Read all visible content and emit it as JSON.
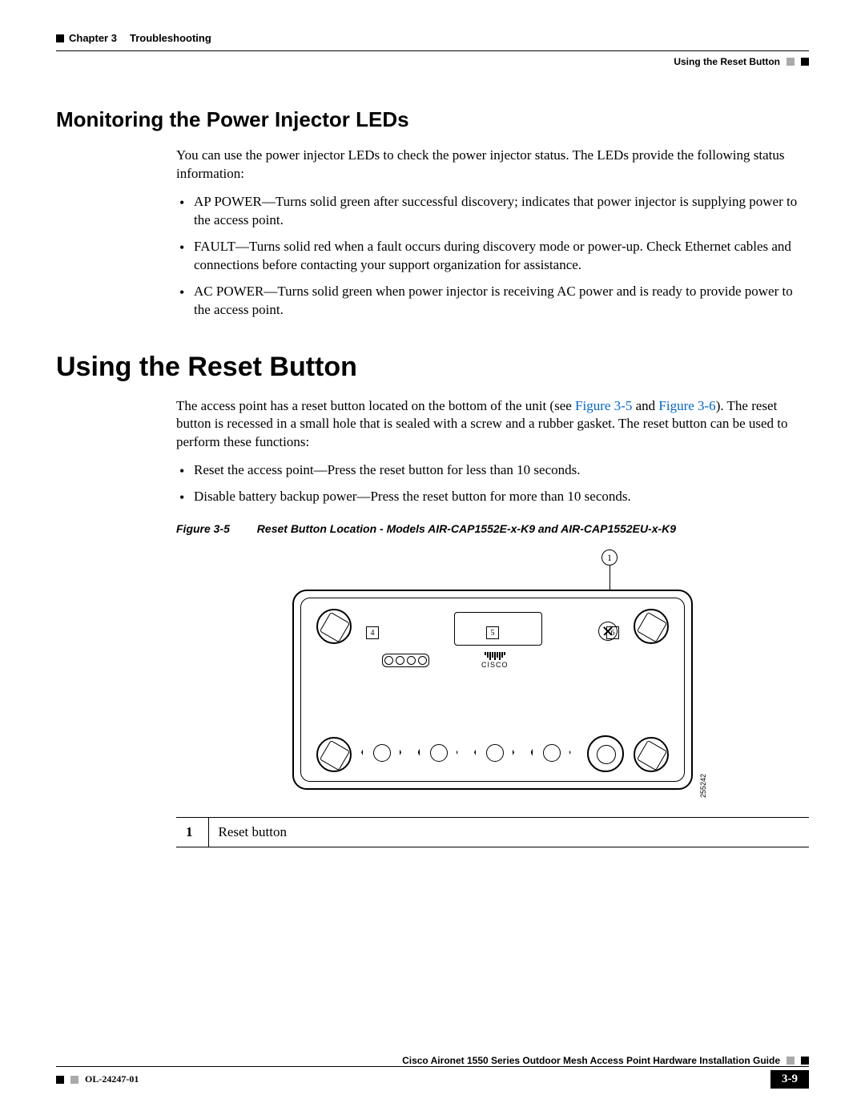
{
  "header": {
    "chapter_label": "Chapter 3",
    "chapter_title": "Troubleshooting",
    "section_crumb": "Using the Reset Button"
  },
  "section1": {
    "heading": "Monitoring the Power Injector LEDs",
    "intro": "You can use the power injector LEDs to check the power injector status. The LEDs provide the following status information:",
    "bullets": [
      "AP POWER—Turns solid green after successful discovery; indicates that power injector is supplying power to the access point.",
      "FAULT—Turns solid red when a fault occurs during discovery mode or power-up. Check Ethernet cables and connections before contacting your support organization for assistance.",
      "AC POWER—Turns solid green when power injector is receiving AC power and is ready to provide power to the access point."
    ]
  },
  "section2": {
    "heading": "Using the Reset Button",
    "intro_pre": "The access point has a reset button located on the bottom of the unit (see ",
    "xref1": "Figure 3-5",
    "intro_mid": " and ",
    "xref2": "Figure 3-6",
    "intro_post": "). The reset button is recessed in a small hole that is sealed with a screw and a rubber gasket. The reset button can be used to perform these functions:",
    "bullets": [
      "Reset the access point—Press the reset button for less than 10 seconds.",
      "Disable battery backup power—Press the reset button for more than 10 seconds."
    ]
  },
  "figure": {
    "label": "Figure 3-5",
    "caption": "Reset Button Location - Models AIR-CAP1552E-x-K9 and AIR-CAP1552EU-x-K9",
    "callout": "1",
    "port_labels": [
      "4",
      "5",
      "6"
    ],
    "logo_text": "CISCO",
    "drawing_number": "255242"
  },
  "legend": {
    "num": "1",
    "text": "Reset button"
  },
  "footer": {
    "guide_title": "Cisco Aironet 1550 Series Outdoor Mesh Access Point Hardware Installation Guide",
    "doc_number": "OL-24247-01",
    "page_number": "3-9"
  }
}
